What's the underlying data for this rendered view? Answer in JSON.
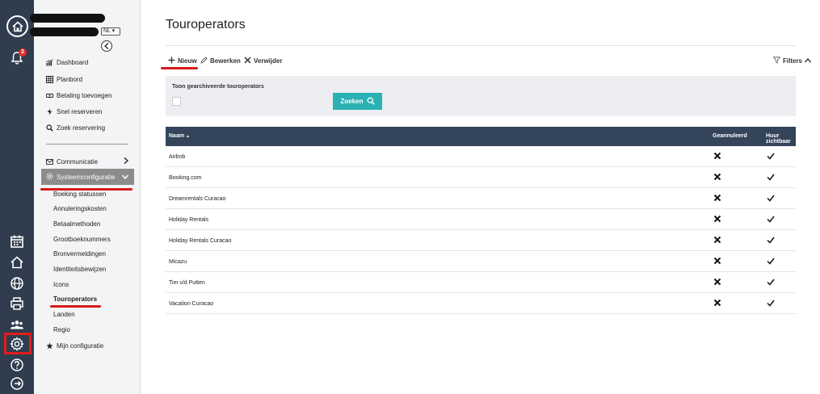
{
  "window": {
    "title": "Touroperators"
  },
  "sidebar": {
    "language": "NL",
    "notification_count": "2",
    "primary_items": [
      {
        "label": "Dashboard",
        "icon": "chart-icon"
      },
      {
        "label": "Planbord",
        "icon": "calendar-grid-icon"
      },
      {
        "label": "Betaling toevoegen",
        "icon": "money-icon"
      },
      {
        "label": "Snel reserveren",
        "icon": "bolt-icon"
      },
      {
        "label": "Zoek reservering",
        "icon": "search-icon"
      }
    ],
    "communicatie": "Communicatie",
    "systeemconfiguratie": "Systeemconfiguratie",
    "sub_items": [
      "Boeking statussen",
      "Annuleringskosten",
      "Betaalmethoden",
      "Grootboeknummers",
      "Bronvermeldingen",
      "Identiteitsbewijzen",
      "Icons",
      "Touroperators",
      "Landen",
      "Regio"
    ],
    "active_sub_item": "Touroperators",
    "mijn_configuratie": "Mijn configuratie"
  },
  "toolbar": {
    "new_label": "Nieuw",
    "edit_label": "Bewerken",
    "delete_label": "Verwijder",
    "filters_label": "Filters"
  },
  "filter_panel": {
    "archived_label": "Toon gearchiveerde touroperators",
    "search_label": "Zoeken"
  },
  "table": {
    "headers": {
      "name": "Naam",
      "cancelled": "Geannuleerd",
      "rent_visible": "Huur zichtbaar"
    },
    "rows": [
      {
        "name": "Airbnb",
        "cancelled": false,
        "rent_visible": true
      },
      {
        "name": "Booking.com",
        "cancelled": false,
        "rent_visible": true
      },
      {
        "name": "Dreamrentals Curacao",
        "cancelled": false,
        "rent_visible": true
      },
      {
        "name": "Holiday Rentals",
        "cancelled": false,
        "rent_visible": true
      },
      {
        "name": "Holiday Rentals Curacao",
        "cancelled": false,
        "rent_visible": true
      },
      {
        "name": "Micazu",
        "cancelled": false,
        "rent_visible": true
      },
      {
        "name": "Tim v/d Putten",
        "cancelled": false,
        "rent_visible": true
      },
      {
        "name": "Vacation Curacao",
        "cancelled": false,
        "rent_visible": true
      }
    ]
  },
  "colors": {
    "rail": "#2f3d4f",
    "accent": "#2ab1b3",
    "table_header": "#34445a",
    "annotation_red": "#d91a1a"
  }
}
